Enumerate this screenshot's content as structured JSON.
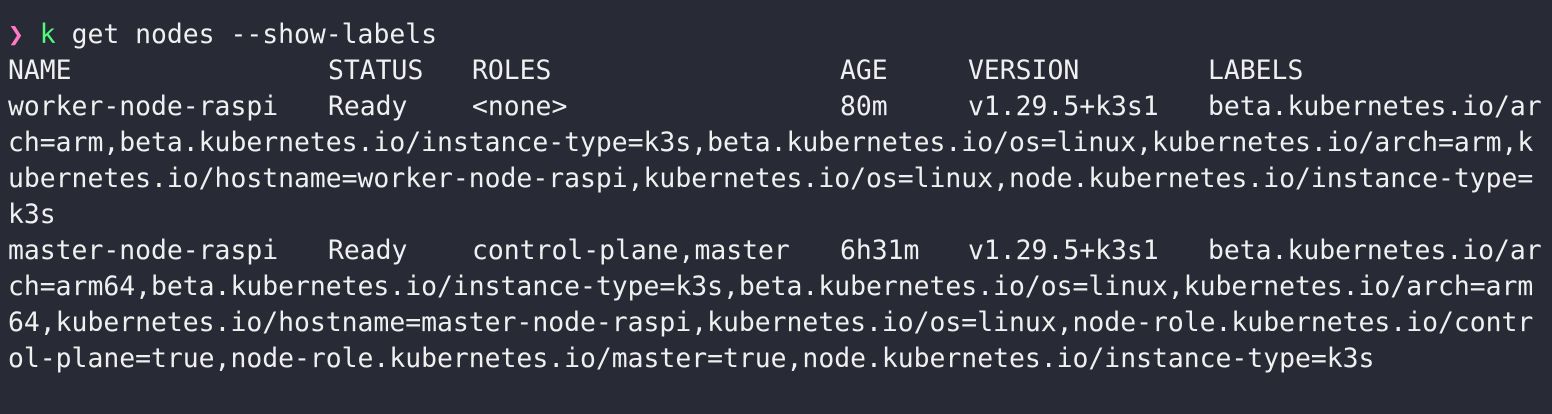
{
  "prompt": {
    "symbol": "❯",
    "command": "k",
    "args": "get nodes --show-labels"
  },
  "table": {
    "headers": [
      "NAME",
      "STATUS",
      "ROLES",
      "AGE",
      "VERSION",
      "LABELS"
    ],
    "rows": [
      {
        "name": "worker-node-raspi",
        "status": "Ready",
        "roles": "<none>",
        "age": "80m",
        "version": "v1.29.5+k3s1",
        "labels_lines": [
          "beta.kubernetes.io/ar",
          "ch=arm,beta.kubernetes.io/instance-type=k3s,beta.kubernetes.io/os=linux,kubernetes.io/arch=arm,k",
          "ubernetes.io/hostname=worker-node-raspi,kubernetes.io/os=linux,node.kubernetes.io/instance-type=",
          "k3s"
        ]
      },
      {
        "name": "master-node-raspi",
        "status": "Ready",
        "roles": "control-plane,master",
        "age": "6h31m",
        "version": "v1.29.5+k3s1",
        "labels_lines": [
          "beta.kubernetes.io/ar",
          "ch=arm64,beta.kubernetes.io/instance-type=k3s,beta.kubernetes.io/os=linux,kubernetes.io/arch=arm",
          "64,kubernetes.io/hostname=master-node-raspi,kubernetes.io/os=linux,node-role.kubernetes.io/contr",
          "ol-plane=true,node-role.kubernetes.io/master=true,node.kubernetes.io/instance-type=k3s"
        ]
      }
    ]
  }
}
